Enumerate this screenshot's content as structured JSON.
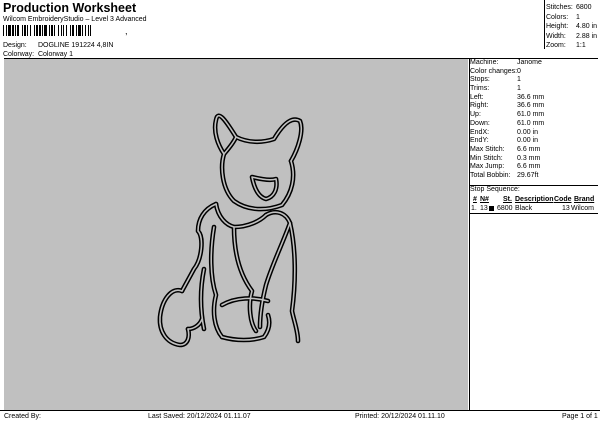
{
  "header": {
    "title": "Production Worksheet",
    "subtitle": "Wilcom EmbroideryStudio – Level 3 Advanced",
    "barcode_suffix": ","
  },
  "design": {
    "label": "Design:",
    "value": "DOGLINE 191224 4,8IN"
  },
  "colorway": {
    "label": "Colorway:",
    "value": "Colorway 1"
  },
  "summary": [
    {
      "k": "Stitches:",
      "v": "6800"
    },
    {
      "k": "Colors:",
      "v": "1"
    },
    {
      "k": "Height:",
      "v": "4.80 in"
    },
    {
      "k": "Width:",
      "v": "2.88 in"
    },
    {
      "k": "Zoom:",
      "v": "1:1"
    }
  ],
  "details": [
    {
      "k": "Machine:",
      "v": "Janome"
    },
    {
      "k": "Color changes:",
      "v": "0"
    },
    {
      "k": "Stops:",
      "v": "1"
    },
    {
      "k": "Trims:",
      "v": "1"
    },
    {
      "k": "Left:",
      "v": "36.6 mm"
    },
    {
      "k": "Right:",
      "v": "36.6 mm"
    },
    {
      "k": "Up:",
      "v": "61.0 mm"
    },
    {
      "k": "Down:",
      "v": "61.0 mm"
    },
    {
      "k": "EndX:",
      "v": "0.00 in"
    },
    {
      "k": "EndY:",
      "v": "0.00 in"
    },
    {
      "k": "Max Stitch:",
      "v": "6.6 mm"
    },
    {
      "k": "Min Stitch:",
      "v": "0.3 mm"
    },
    {
      "k": "Max Jump:",
      "v": "6.6 mm"
    },
    {
      "k": "Total Bobbin:",
      "v": "29.67ft"
    }
  ],
  "stop_sequence": {
    "heading": "Stop Sequence:",
    "columns": [
      "#",
      "N#",
      "St.",
      "Description",
      "Code",
      "Brand"
    ],
    "rows": [
      {
        "num": "1.",
        "n": "13",
        "st": "6800",
        "desc": "Black",
        "code": "13",
        "brand": "Wilcom",
        "color": "#000000"
      }
    ]
  },
  "footer": {
    "created_by": "Created By:",
    "last_saved": "Last Saved: 20/12/2024 01.11.07",
    "printed": "Printed: 20/12/2024 01.11.10",
    "page": "Page 1 of 1"
  },
  "colors": {
    "canvas_bg": "#c0c0c0",
    "thread": "#000000"
  }
}
